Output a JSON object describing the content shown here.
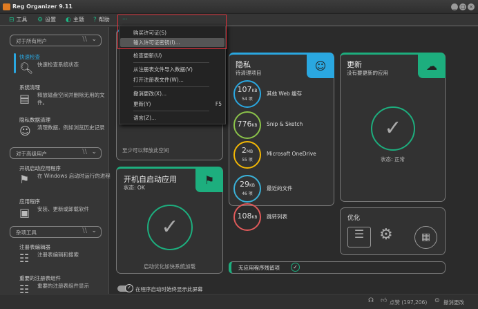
{
  "window": {
    "title": "Reg Organizer 9.11"
  },
  "toolbar": {
    "tools": "工具",
    "settings": "设置",
    "theme": "主题",
    "help": "帮助",
    "more": "..."
  },
  "sidebar": {
    "section1": "对于所有用户",
    "items1": [
      {
        "title": "快速检查",
        "desc": "快速检查系统状态"
      },
      {
        "title": "系统清理",
        "desc": "释放磁盘空间并删除无用的文件。"
      },
      {
        "title": "隐私数据清理",
        "desc": "清理数据，例如浏览历史记录"
      }
    ],
    "section2": "对于高级用户",
    "items2": [
      {
        "title": "开机启动应用程序",
        "desc": "在 Windows 启动时运行的进程"
      },
      {
        "title": "应用程序",
        "desc": "安装、更新或卸载软件"
      }
    ],
    "section3": "杂项工具",
    "items3": [
      {
        "title": "注册表编辑器",
        "desc": "注册表编辑和搜索"
      },
      {
        "title": "重要的注册表组件",
        "desc": "重要的注册表组件显示"
      }
    ]
  },
  "menu": {
    "items": [
      {
        "label": "购买许可证(S)"
      },
      {
        "label": "输入许可证密钥(I)..."
      },
      {
        "label": "检查更新(U)"
      },
      {
        "label": "从注册表文件导入数据(V)"
      },
      {
        "label": "打开注册表文件(W)..."
      },
      {
        "label": "撤消更改(X)..."
      },
      {
        "label": "更新(Y)",
        "shortcut": "F5"
      },
      {
        "label": "语言(Z)..."
      }
    ]
  },
  "cleanup_card": {
    "footer": "至少可以释放此空间"
  },
  "startup_card": {
    "title": "开机自启动应用",
    "status": "状态: OK",
    "footer": "启动优化加快系统加载"
  },
  "privacy_card": {
    "title": "隐私",
    "subtitle": "待清理项目",
    "items": [
      {
        "size": "107",
        "unit": "KB",
        "count": "54 项",
        "label": "其他 Web 缓存",
        "color": "#2aa7e0"
      },
      {
        "size": "776",
        "unit": "KB",
        "count": "",
        "label": "Snip & Sketch",
        "color": "#8bc34a"
      },
      {
        "size": "2",
        "unit": "MB",
        "count": "55 项",
        "label": "Microsoft OneDrive",
        "color": "#f2b705"
      },
      {
        "size": "29",
        "unit": "KB",
        "count": "46 项",
        "label": "最近的文件",
        "color": "#3ab0d6"
      },
      {
        "size": "108",
        "unit": "KB",
        "count": "",
        "label": "跳转列表",
        "color": "#e05a5a"
      }
    ]
  },
  "update_card": {
    "title": "更新",
    "subtitle": "没有要更新的应用",
    "status": "状态: 正常"
  },
  "optimize_card": {
    "title": "优化"
  },
  "leftovers": {
    "label": "无应用程序残留项"
  },
  "toggle": {
    "label": "在程序启动时始终显示此屏幕"
  },
  "statusbar": {
    "like": "点赞 (197,206)",
    "undo": "撤消更改"
  },
  "colors": {
    "accent_green": "#1dae7e",
    "accent_blue": "#2aa7e0",
    "highlight_red": "#e0323c"
  }
}
